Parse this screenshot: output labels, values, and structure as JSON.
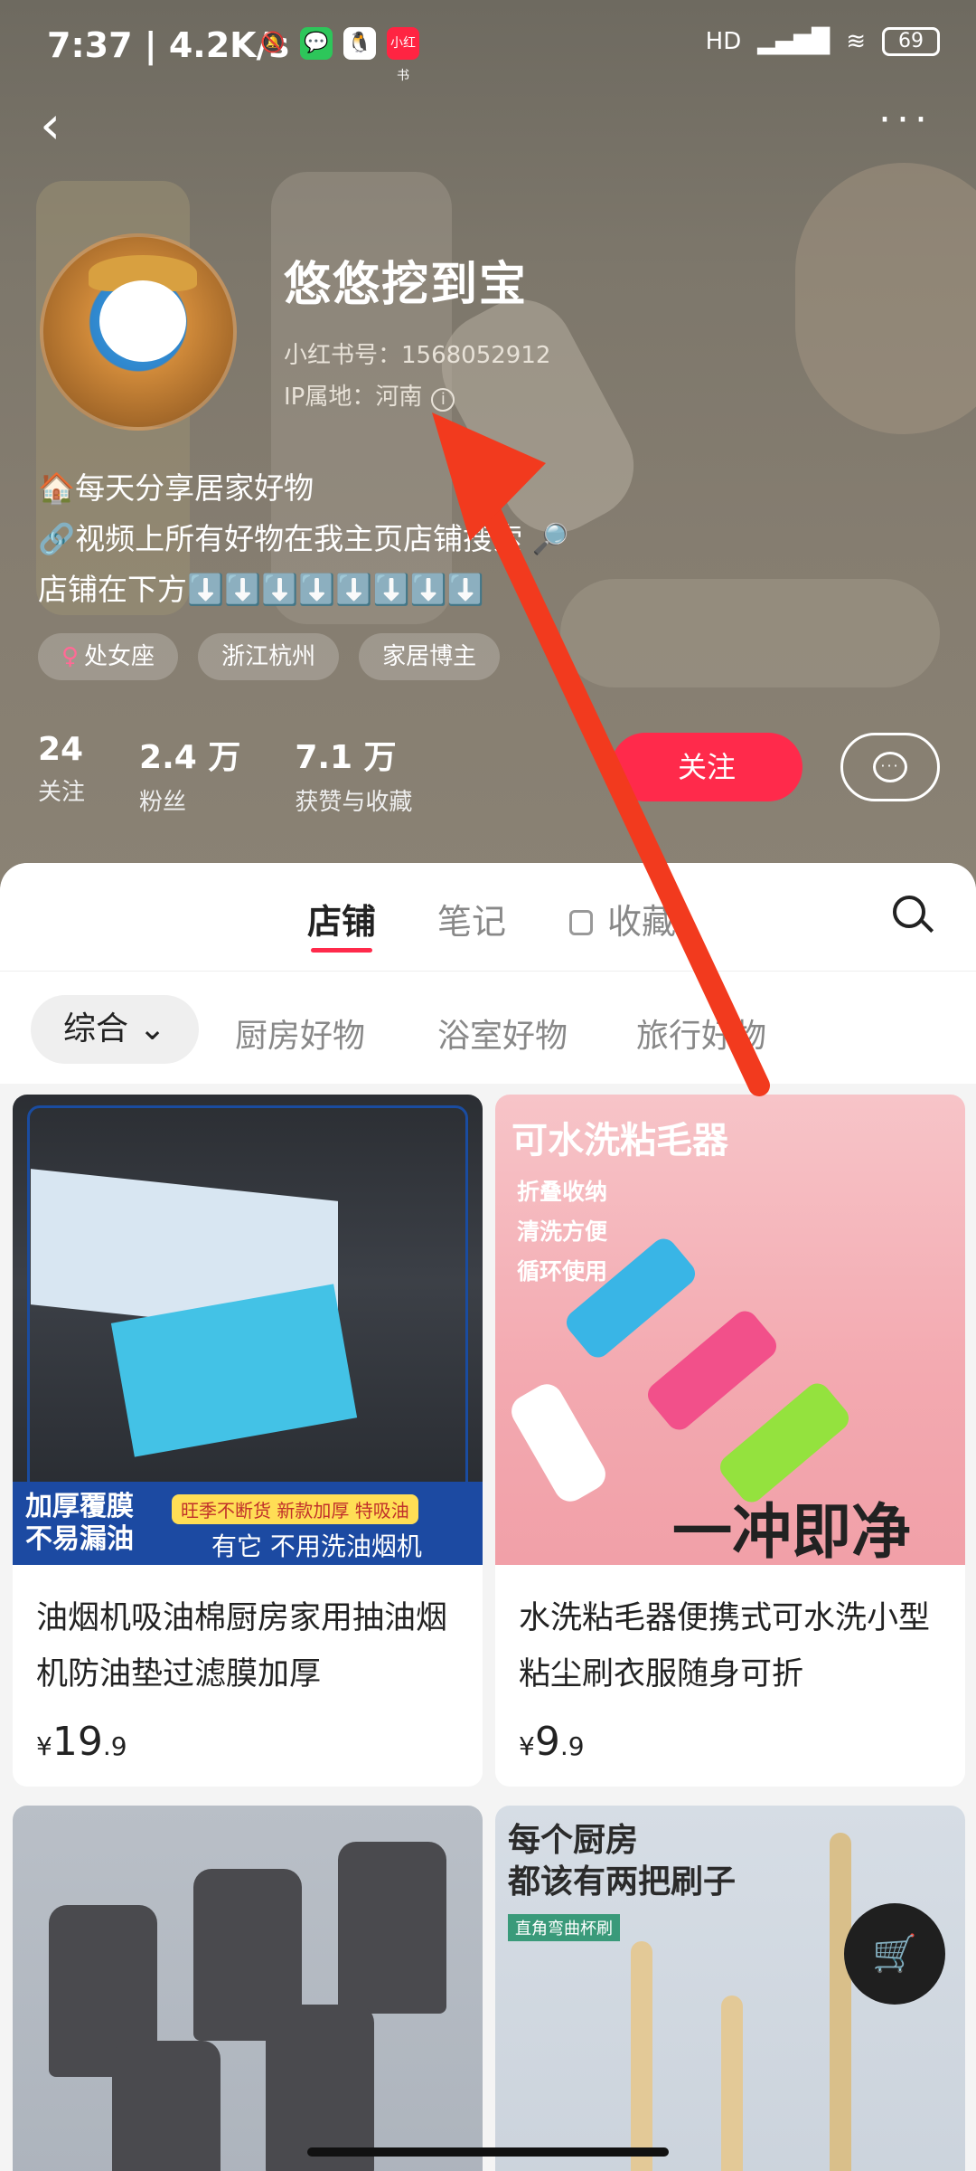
{
  "status": {
    "time": "7:37 | 4.2K/s",
    "network": "HD",
    "battery": "69"
  },
  "profile": {
    "name": "悠悠挖到宝",
    "red_id": "小红书号：1568052912",
    "ip": "IP属地：河南",
    "bio": [
      "🏠每天分享居家好物",
      "🔗视频上所有好物在我主页店铺搜索 🔎",
      "店铺在下方⬇️⬇️⬇️⬇️⬇️⬇️⬇️⬇️"
    ],
    "tags": [
      "处女座",
      "浙江杭州",
      "家居博主"
    ],
    "stats": [
      {
        "value": "24",
        "label": "关注"
      },
      {
        "value": "2.4 万",
        "label": "粉丝"
      },
      {
        "value": "7.1 万",
        "label": "获赞与收藏"
      }
    ],
    "follow_label": "关注"
  },
  "tabs": [
    {
      "label": "店铺"
    },
    {
      "label": "笔记"
    },
    {
      "label": "收藏"
    }
  ],
  "categories": [
    "综合",
    "厨房好物",
    "浴室好物",
    "旅行好物"
  ],
  "products": [
    {
      "title": "油烟机吸油棉厨房家用抽油烟机防油垫过滤膜加厚",
      "price_int": "19",
      "price_dec": ".9",
      "img_text1": "加厚覆膜\n不易漏油",
      "img_text2": "旺季不断货 新款加厚 特吸油",
      "img_text3": "有它 不用洗油烟机"
    },
    {
      "title": "水洗粘毛器便携式可水洗小型粘尘刷衣服随身可折",
      "price_int": "9",
      "price_dec": ".9",
      "img_text1": "可水洗粘毛器",
      "img_text2": "折叠收纳\n清洗方便\n循环使用",
      "img_text3": "一冲即净"
    },
    {
      "img_text1": ""
    },
    {
      "img_text1": "每个厨房\n都该有两把刷子",
      "img_text2": "直角弯曲杯刷"
    }
  ],
  "currency": "¥",
  "colors": {
    "accent": "#ff2a4b",
    "annotation_arrow": "#f23a1e"
  }
}
